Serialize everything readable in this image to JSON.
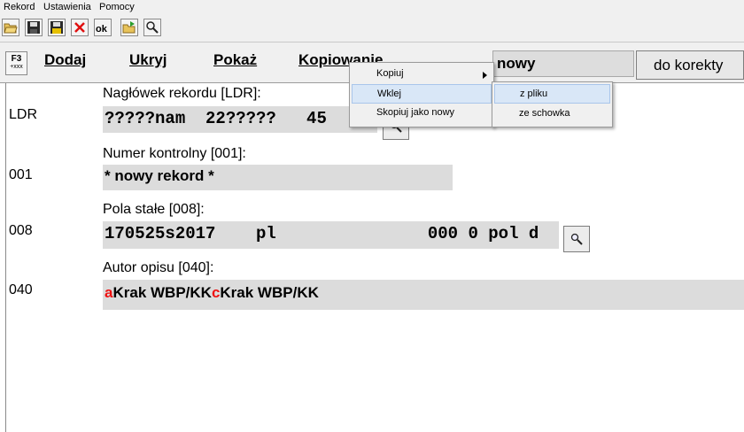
{
  "menubar": {
    "items": [
      "Rekord",
      "Ustawienia",
      "Pomocy"
    ]
  },
  "toolbar": {
    "buttons": [
      "open-icon",
      "save-icon",
      "save-as-icon",
      "delete-icon",
      "ok-icon",
      "import-icon",
      "search-icon"
    ],
    "ok_label": "ok"
  },
  "actionbar": {
    "f3_top": "F3",
    "f3_bottom": "+xxx",
    "actions": [
      "Dodaj",
      "Ukryj",
      "Pokaż",
      "Kopiowanie"
    ],
    "status": "nowy",
    "correction_button": "do korekty"
  },
  "fields": [
    {
      "tag": "LDR",
      "label": "Nagłówek rekordu [LDR]:",
      "value": "?????nam  22?????   45"
    },
    {
      "tag": "001",
      "label": "Numer kontrolny [001]:",
      "value": "* nowy rekord *"
    },
    {
      "tag": "008",
      "label": "Pola stałe [008]:",
      "value": "170525s2017    pl               000 0 pol d"
    },
    {
      "tag": "040",
      "label": "Autor opisu [040]:",
      "subfields": [
        {
          "code": "a",
          "text": "Krak WBP/KK"
        },
        {
          "code": "c",
          "text": "Krak WBP/KK"
        }
      ]
    }
  ],
  "context_menu": {
    "items": [
      "Kopiuj",
      "Wklej",
      "Skopiuj jako nowy"
    ],
    "submenu": [
      "z pliku",
      "ze schowka"
    ]
  },
  "colors": {
    "subfield_code": "#e11111",
    "field_bg": "#dcdcdc",
    "highlight": "#d9e7f7"
  }
}
